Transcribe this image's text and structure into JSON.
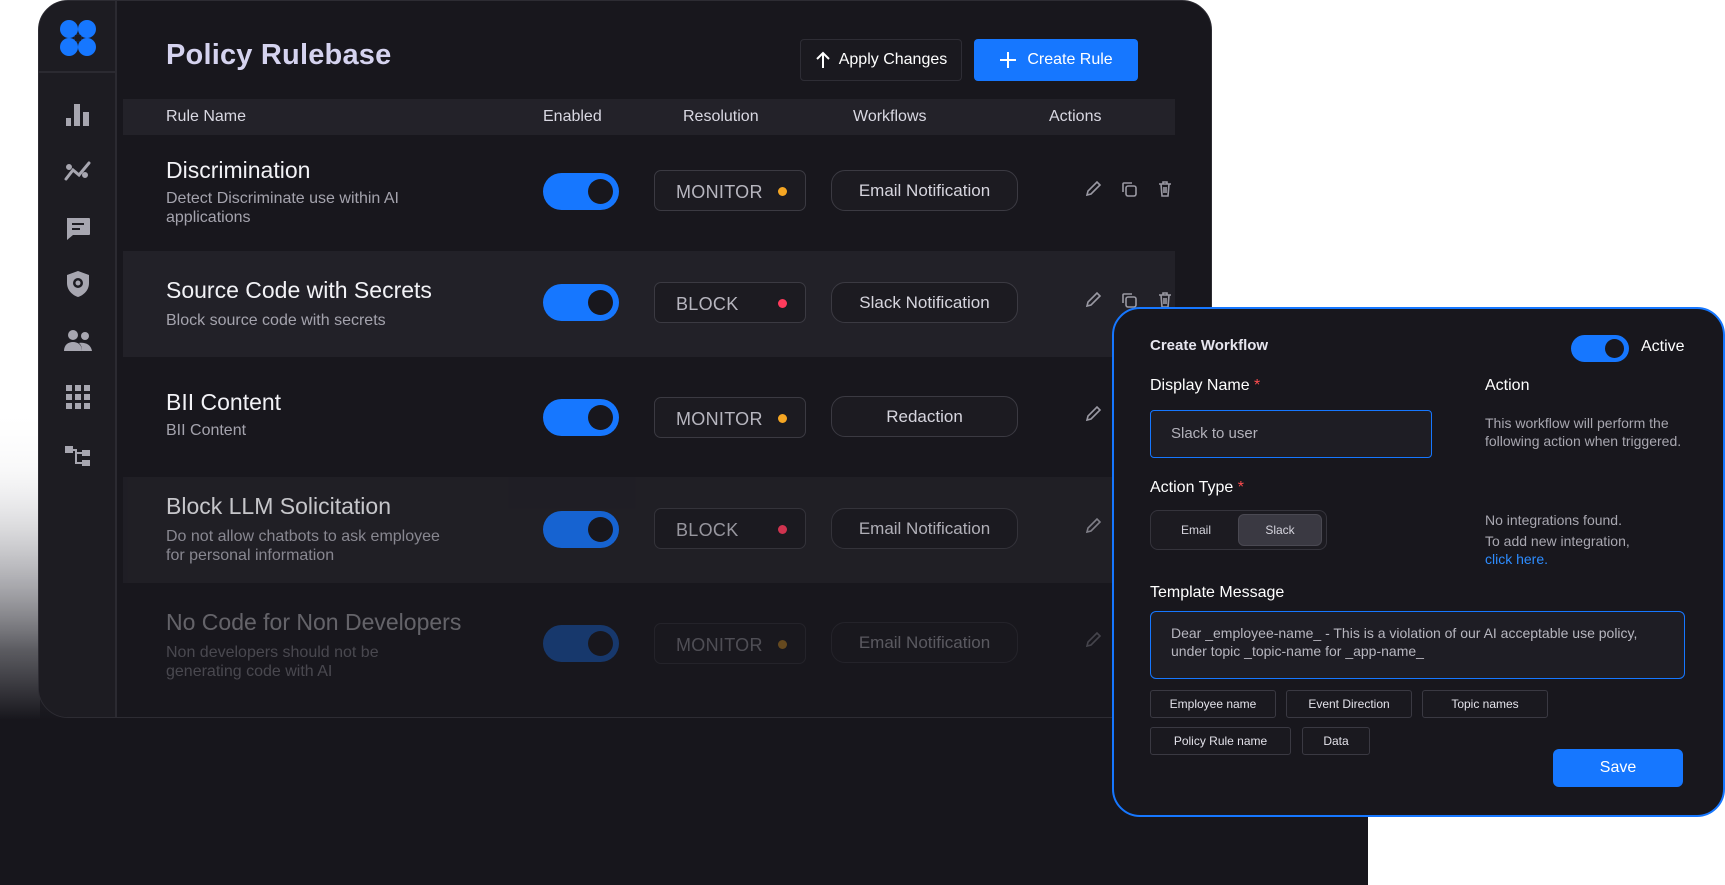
{
  "app": {
    "title": "Policy Rulebase",
    "apply_label": "Apply Changes",
    "create_label": "Create Rule"
  },
  "sidebar": {
    "items": [
      {
        "icon": "bar-chart-icon"
      },
      {
        "icon": "trend-analytics-icon"
      },
      {
        "icon": "chat-icon"
      },
      {
        "icon": "shield-icon"
      },
      {
        "icon": "users-icon"
      },
      {
        "icon": "apps-grid-icon"
      },
      {
        "icon": "hierarchy-icon"
      }
    ]
  },
  "table": {
    "headers": [
      "Rule Name",
      "Enabled",
      "Resolution",
      "Workflows",
      "Actions"
    ],
    "rows": [
      {
        "name": "Discrimination",
        "desc": "Detect Discriminate use within AI applications",
        "enabled": true,
        "resolution": "MONITOR",
        "status_color": "#f5a623",
        "workflow": "Email Notification"
      },
      {
        "name": "Source Code with Secrets",
        "desc": "Block source code with secrets",
        "enabled": true,
        "resolution": "BLOCK",
        "status_color": "#ff3b5c",
        "workflow": "Slack Notification"
      },
      {
        "name": "BII Content",
        "desc": "BII Content",
        "enabled": true,
        "resolution": "MONITOR",
        "status_color": "#f5a623",
        "workflow": "Redaction"
      },
      {
        "name": "Block LLM Solicitation",
        "desc": "Do not allow chatbots to ask employee for personal information",
        "enabled": true,
        "resolution": "BLOCK",
        "status_color": "#ff3b5c",
        "workflow": "Email Notification"
      },
      {
        "name": "No Code for Non Developers",
        "desc": "Non developers should not be generating code with AI",
        "enabled": true,
        "resolution": "MONITOR",
        "status_color": "#f5a623",
        "workflow": "Email Notification"
      }
    ]
  },
  "modal": {
    "title": "Create Workflow",
    "active_label": "Active",
    "display_name_label": "Display Name",
    "required_mark": "*",
    "display_name_placeholder": "Slack to user",
    "action_label": "Action",
    "action_note": "This workflow will perform the following action when triggered.",
    "action_type_label": "Action Type",
    "action_types": [
      "Email",
      "Slack"
    ],
    "selected_action_type": "Slack",
    "no_integrations": "No integrations found.",
    "add_integration": "To add new integration,",
    "click_here": "click here.",
    "template_label": "Template Message",
    "template_value": "Dear _employee-name_ - This is a violation of our AI acceptable use policy, under topic _topic-name for _app-name_",
    "chips": [
      "Employee name",
      "Event Direction",
      "Topic names",
      "Policy Rule name",
      "Data"
    ],
    "save_label": "Save"
  },
  "colors": {
    "accent": "#1677ff",
    "monitor": "#f5a623",
    "block": "#ff3b5c"
  }
}
